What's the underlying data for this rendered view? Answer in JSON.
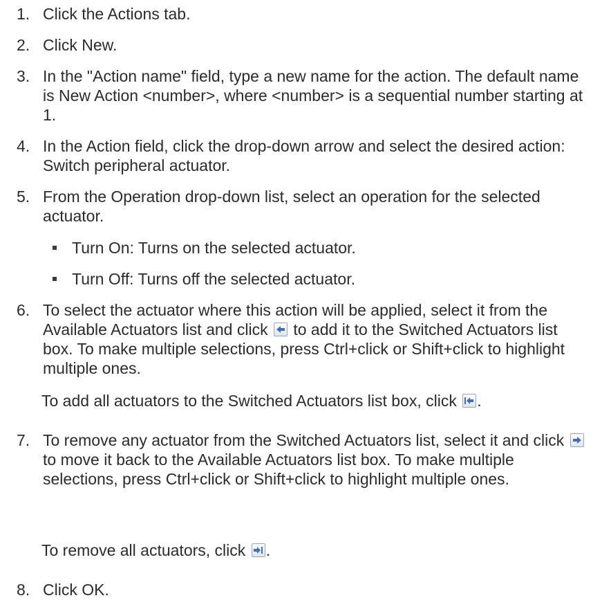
{
  "steps": [
    {
      "num": "1.",
      "text": "Click the Actions tab."
    },
    {
      "num": "2.",
      "text": "Click New."
    },
    {
      "num": "3.",
      "text": "In the \"Action name\" field, type a new name for the action. The default name is New Action <number>, where <number> is a sequential number starting at 1."
    },
    {
      "num": "4.",
      "text": "In the Action field, click the drop-down arrow and select the desired action: Switch peripheral actuator."
    },
    {
      "num": "5.",
      "text": "From the Operation drop-down list, select an operation for the selected actuator."
    },
    {
      "num": "6.",
      "text_before": "To select the actuator where this action will be applied, select it from the Available Actuators list and click",
      "text_after": "to add it to the Switched Actuators list box. To make multiple selections, press Ctrl+click or Shift+click to highlight multiple ones."
    },
    {
      "num": "7.",
      "text_before": "To remove any actuator from the Switched Actuators list, select it and click",
      "text_after": "to move it back to the Available Actuators list box. To make multiple selections, press Ctrl+click or Shift+click to highlight multiple ones."
    },
    {
      "num": "8.",
      "text": "Click OK."
    }
  ],
  "operations": [
    "Turn On: Turns on the selected actuator.",
    "Turn Off: Turns off the selected actuator."
  ],
  "notes": {
    "add_all": "To add all actuators to the Switched Actuators list box, click",
    "remove_all": "To remove all actuators, click",
    "period": "."
  },
  "icons": {
    "add": "arrow-left-icon",
    "add_all": "arrow-left-bar-icon",
    "remove": "arrow-right-icon",
    "remove_all": "arrow-right-bar-icon",
    "accent": "#3a6fc4"
  }
}
